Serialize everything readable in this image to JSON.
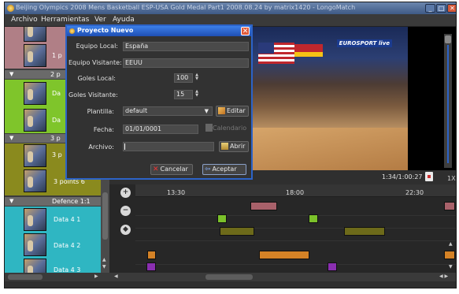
{
  "window": {
    "title": "Beijing Olympics 2008 Mens Basketball ESP-USA Gold Medal Part1 2008.08.24 by matrix1420 - LongoMatch"
  },
  "menubar": {
    "archivo": "Archivo",
    "herramientas": "Herramientas",
    "ver": "Ver",
    "ayuda": "Ayuda"
  },
  "left_panel": {
    "items": [
      {
        "label": "1 p"
      },
      {
        "label": "Da"
      },
      {
        "label": "Da"
      },
      {
        "label": "3 p"
      },
      {
        "label": "3 points 6"
      },
      {
        "label": "Data 4 1"
      },
      {
        "label": "Data 4 2"
      },
      {
        "label": "Data 4 3"
      }
    ],
    "categories": [
      {
        "label": "2 p",
        "color": "#7fc52b"
      },
      {
        "label": "3 p",
        "color": "#8a8a1e"
      },
      {
        "label": "Defence 1:1",
        "color": "#2fb6c2"
      }
    ]
  },
  "video": {
    "broadcaster_logo": "EUROSPORT live",
    "time": "1:34/1:00:27",
    "speed": "1X"
  },
  "timeline": {
    "ticks": [
      "13:30",
      "18:00",
      "22:30"
    ],
    "colors": {
      "pink": "#a8616a",
      "green": "#7bc12a",
      "olive": "#7d7a1e",
      "orange": "#d48226",
      "purple": "#8a2fb0"
    }
  },
  "dialog": {
    "title": "Proyecto Nuevo",
    "equipo_local_label": "Equipo Local:",
    "equipo_local_value": "España",
    "equipo_visitante_label": "Equipo Visitante:",
    "equipo_visitante_value": "EEUU",
    "goles_local_label": "Goles Local:",
    "goles_local_value": "100",
    "goles_visitante_label": "Goles Visitante:",
    "goles_visitante_value": "15",
    "plantilla_label": "Plantilla:",
    "plantilla_value": "default",
    "editar_label": "Editar",
    "fecha_label": "Fecha:",
    "fecha_value": "01/01/0001",
    "calendario_label": "Calendario",
    "archivo_label": "Archivo:",
    "archivo_value": "",
    "abrir_label": "Abrir",
    "cancelar_label": "Cancelar",
    "aceptar_label": "Aceptar"
  }
}
